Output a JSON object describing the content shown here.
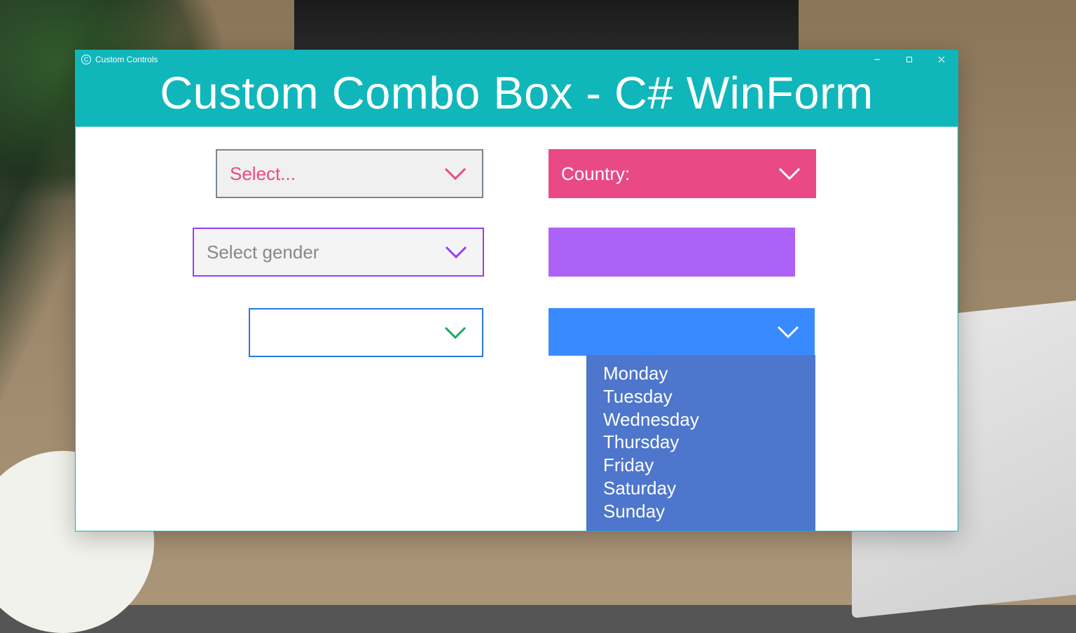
{
  "window": {
    "title": "Custom Controls",
    "heading": "Custom Combo Box - C# WinForm"
  },
  "combos": {
    "select": {
      "label": "Select..."
    },
    "country": {
      "label": "Country:"
    },
    "gender": {
      "label": "Select gender"
    },
    "purple": {
      "label": ""
    },
    "blue_outline": {
      "label": ""
    },
    "day": {
      "label": ""
    }
  },
  "day_options": {
    "0": "Monday",
    "1": "Tuesday",
    "2": "Wednesday",
    "3": "Thursday",
    "4": "Friday",
    "5": "Saturday",
    "6": "Sunday"
  }
}
